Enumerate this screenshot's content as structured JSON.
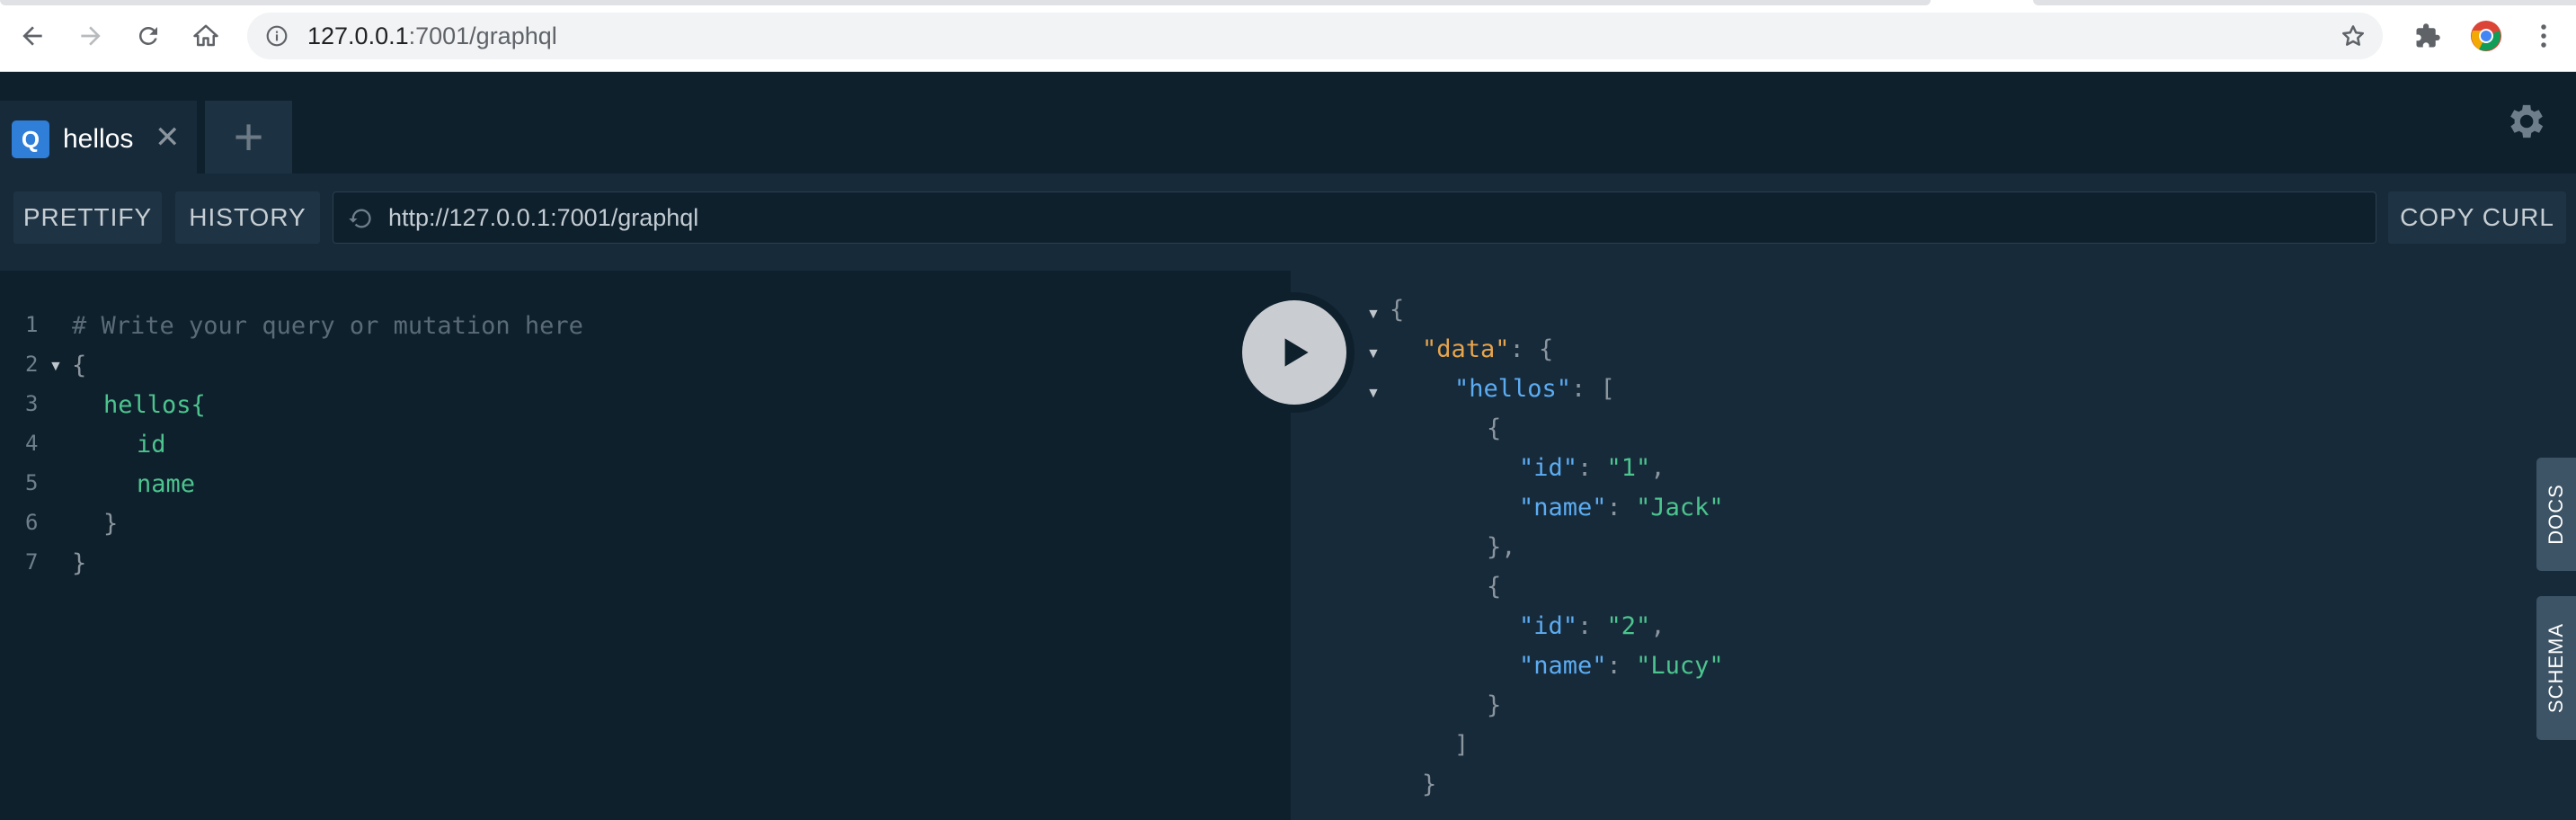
{
  "browser": {
    "url_host": "127.0.0.1",
    "url_path": ":7001/graphql"
  },
  "tabs": [
    {
      "badge": "Q",
      "label": "hellos",
      "close": "✕"
    }
  ],
  "new_tab_label": "+",
  "toolbar": {
    "prettify_label": "PRETTIFY",
    "history_label": "HISTORY",
    "endpoint": "http://127.0.0.1:7001/graphql",
    "copy_curl_label": "COPY CURL"
  },
  "editor": {
    "line_numbers": [
      "1",
      "2",
      "3",
      "4",
      "5",
      "6",
      "7"
    ],
    "lines": [
      "# Write your query or mutation here",
      "{",
      "hellos{",
      "id",
      "name",
      "}",
      "}"
    ]
  },
  "result": {
    "root_key": "\"data\"",
    "list_key": "\"hellos\"",
    "items": [
      {
        "id_key": "\"id\"",
        "id_value": "\"1\"",
        "name_key": "\"name\"",
        "name_value": "\"Jack\""
      },
      {
        "id_key": "\"id\"",
        "id_value": "\"2\"",
        "name_key": "\"name\"",
        "name_value": "\"Lucy\""
      }
    ]
  },
  "side_tabs": {
    "docs_label": "DOCS",
    "schema_label": "SCHEMA"
  },
  "colors": {
    "accent": "#2f7ed8",
    "key": "#5cacf2",
    "string": "#4cc48e",
    "root_key": "#e8a44a",
    "editor_bg": "#0f202d",
    "panel_bg": "#172a3a"
  },
  "icons": {
    "back": "back-arrow-icon",
    "forward": "forward-arrow-icon",
    "reload": "reload-icon",
    "home": "home-icon",
    "info": "info-icon",
    "bookmark": "star-icon",
    "extensions": "puzzle-icon",
    "profile": "chrome-profile-icon",
    "menu": "kebab-menu-icon",
    "settings": "gear-icon",
    "run": "play-icon",
    "history": "history-icon"
  }
}
